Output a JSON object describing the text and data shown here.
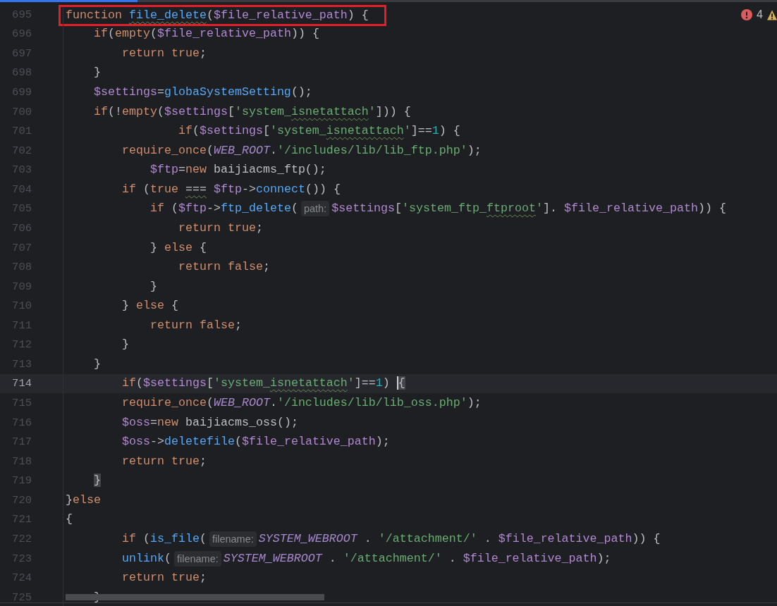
{
  "problems": {
    "errors": "4"
  },
  "lines": [
    {
      "number": "695",
      "current": false,
      "boxed": true,
      "tokens": [
        {
          "text": "function ",
          "kind": "kw"
        },
        {
          "text": "file_delete",
          "kind": "fn",
          "squiggle": true
        },
        {
          "text": "(",
          "kind": "plain"
        },
        {
          "text": "$file_relative_path",
          "kind": "var"
        },
        {
          "text": ") {",
          "kind": "plain"
        }
      ]
    },
    {
      "number": "696",
      "current": false,
      "boxed": false,
      "tokens": [
        {
          "text": "    if",
          "kind": "kw"
        },
        {
          "text": "(",
          "kind": "plain"
        },
        {
          "text": "empty",
          "kind": "kw"
        },
        {
          "text": "(",
          "kind": "plain"
        },
        {
          "text": "$file_relative_path",
          "kind": "var"
        },
        {
          "text": ")) {",
          "kind": "plain"
        }
      ]
    },
    {
      "number": "697",
      "current": false,
      "boxed": false,
      "tokens": [
        {
          "text": "        return true",
          "kind": "kw"
        },
        {
          "text": ";",
          "kind": "plain"
        }
      ]
    },
    {
      "number": "698",
      "current": false,
      "boxed": false,
      "tokens": [
        {
          "text": "    }",
          "kind": "plain"
        }
      ]
    },
    {
      "number": "699",
      "current": false,
      "boxed": false,
      "tokens": [
        {
          "text": "    $settings",
          "kind": "var"
        },
        {
          "text": "=",
          "kind": "plain"
        },
        {
          "text": "globaSystemSetting",
          "kind": "fn"
        },
        {
          "text": "();",
          "kind": "plain"
        }
      ]
    },
    {
      "number": "700",
      "current": false,
      "boxed": false,
      "tokens": [
        {
          "text": "    if",
          "kind": "kw"
        },
        {
          "text": "(!",
          "kind": "plain"
        },
        {
          "text": "empty",
          "kind": "kw"
        },
        {
          "text": "(",
          "kind": "plain"
        },
        {
          "text": "$settings",
          "kind": "var"
        },
        {
          "text": "[",
          "kind": "plain"
        },
        {
          "text": "'system_",
          "kind": "str"
        },
        {
          "text": "isnetattach",
          "kind": "str",
          "squiggle": true
        },
        {
          "text": "'",
          "kind": "str"
        },
        {
          "text": "])) {",
          "kind": "plain"
        }
      ]
    },
    {
      "number": "701",
      "current": false,
      "boxed": false,
      "tokens": [
        {
          "text": "                if",
          "kind": "kw"
        },
        {
          "text": "(",
          "kind": "plain"
        },
        {
          "text": "$settings",
          "kind": "var"
        },
        {
          "text": "[",
          "kind": "plain"
        },
        {
          "text": "'system_",
          "kind": "str"
        },
        {
          "text": "isnetattach",
          "kind": "str",
          "squiggle": true
        },
        {
          "text": "'",
          "kind": "str"
        },
        {
          "text": "]==",
          "kind": "plain"
        },
        {
          "text": "1",
          "kind": "num"
        },
        {
          "text": ") {",
          "kind": "plain"
        }
      ]
    },
    {
      "number": "702",
      "current": false,
      "boxed": false,
      "tokens": [
        {
          "text": "        require_once",
          "kind": "kw"
        },
        {
          "text": "(",
          "kind": "plain"
        },
        {
          "text": "WEB_ROOT",
          "kind": "const"
        },
        {
          "text": ".",
          "kind": "plain"
        },
        {
          "text": "'/includes/lib/lib_ftp.php'",
          "kind": "str"
        },
        {
          "text": ");",
          "kind": "plain"
        }
      ]
    },
    {
      "number": "703",
      "current": false,
      "boxed": false,
      "tokens": [
        {
          "text": "            $ftp",
          "kind": "var"
        },
        {
          "text": "=",
          "kind": "plain"
        },
        {
          "text": "new",
          "kind": "kw"
        },
        {
          "text": " baijiacms_ftp();",
          "kind": "plain"
        }
      ]
    },
    {
      "number": "704",
      "current": false,
      "boxed": false,
      "tokens": [
        {
          "text": "        if",
          "kind": "kw"
        },
        {
          "text": " (",
          "kind": "plain"
        },
        {
          "text": "true ",
          "kind": "kw"
        },
        {
          "text": "===",
          "kind": "plain",
          "squiggle": true
        },
        {
          "text": " $ftp",
          "kind": "var"
        },
        {
          "text": "->",
          "kind": "plain"
        },
        {
          "text": "connect",
          "kind": "fn"
        },
        {
          "text": "()) {",
          "kind": "plain"
        }
      ]
    },
    {
      "number": "705",
      "current": false,
      "boxed": false,
      "tokens": [
        {
          "text": "            if",
          "kind": "kw"
        },
        {
          "text": " (",
          "kind": "plain"
        },
        {
          "text": "$ftp",
          "kind": "var"
        },
        {
          "text": "->",
          "kind": "plain"
        },
        {
          "text": "ftp_delete",
          "kind": "fn"
        },
        {
          "text": "(",
          "kind": "plain"
        },
        {
          "text": "path:",
          "kind": "hint"
        },
        {
          "text": "$settings",
          "kind": "var"
        },
        {
          "text": "[",
          "kind": "plain"
        },
        {
          "text": "'system_ftp_",
          "kind": "str"
        },
        {
          "text": "ftproot",
          "kind": "str",
          "squiggle": true
        },
        {
          "text": "'",
          "kind": "str"
        },
        {
          "text": "]. ",
          "kind": "plain"
        },
        {
          "text": "$file_relative_path",
          "kind": "var"
        },
        {
          "text": ")) {",
          "kind": "plain"
        }
      ]
    },
    {
      "number": "706",
      "current": false,
      "boxed": false,
      "tokens": [
        {
          "text": "                return true",
          "kind": "kw"
        },
        {
          "text": ";",
          "kind": "plain"
        }
      ]
    },
    {
      "number": "707",
      "current": false,
      "boxed": false,
      "tokens": [
        {
          "text": "            } ",
          "kind": "plain"
        },
        {
          "text": "else",
          "kind": "kw"
        },
        {
          "text": " {",
          "kind": "plain"
        }
      ]
    },
    {
      "number": "708",
      "current": false,
      "boxed": false,
      "tokens": [
        {
          "text": "                return false",
          "kind": "kw"
        },
        {
          "text": ";",
          "kind": "plain"
        }
      ]
    },
    {
      "number": "709",
      "current": false,
      "boxed": false,
      "tokens": [
        {
          "text": "            }",
          "kind": "plain"
        }
      ]
    },
    {
      "number": "710",
      "current": false,
      "boxed": false,
      "tokens": [
        {
          "text": "        } ",
          "kind": "plain"
        },
        {
          "text": "else",
          "kind": "kw"
        },
        {
          "text": " {",
          "kind": "plain"
        }
      ]
    },
    {
      "number": "711",
      "current": false,
      "boxed": false,
      "tokens": [
        {
          "text": "            return false",
          "kind": "kw"
        },
        {
          "text": ";",
          "kind": "plain"
        }
      ]
    },
    {
      "number": "712",
      "current": false,
      "boxed": false,
      "tokens": [
        {
          "text": "        }",
          "kind": "plain"
        }
      ]
    },
    {
      "number": "713",
      "current": false,
      "boxed": false,
      "tokens": [
        {
          "text": "    }",
          "kind": "plain"
        }
      ]
    },
    {
      "number": "714",
      "current": true,
      "boxed": false,
      "tokens": [
        {
          "text": "        if",
          "kind": "kw"
        },
        {
          "text": "(",
          "kind": "plain"
        },
        {
          "text": "$settings",
          "kind": "var"
        },
        {
          "text": "[",
          "kind": "plain"
        },
        {
          "text": "'system_",
          "kind": "str"
        },
        {
          "text": "isnetattach",
          "kind": "str",
          "squiggle": true
        },
        {
          "text": "'",
          "kind": "str"
        },
        {
          "text": "]==",
          "kind": "plain"
        },
        {
          "text": "1",
          "kind": "num"
        },
        {
          "text": ") ",
          "kind": "plain"
        },
        {
          "text": "{",
          "kind": "plain",
          "brace_match": true,
          "caret": true
        }
      ]
    },
    {
      "number": "715",
      "current": false,
      "boxed": false,
      "tokens": [
        {
          "text": "        require_once",
          "kind": "kw"
        },
        {
          "text": "(",
          "kind": "plain"
        },
        {
          "text": "WEB_ROOT",
          "kind": "const"
        },
        {
          "text": ".",
          "kind": "plain"
        },
        {
          "text": "'/includes/lib/lib_oss.php'",
          "kind": "str"
        },
        {
          "text": ");",
          "kind": "plain"
        }
      ]
    },
    {
      "number": "716",
      "current": false,
      "boxed": false,
      "tokens": [
        {
          "text": "        $oss",
          "kind": "var"
        },
        {
          "text": "=",
          "kind": "plain"
        },
        {
          "text": "new",
          "kind": "kw"
        },
        {
          "text": " baijiacms_oss();",
          "kind": "plain"
        }
      ]
    },
    {
      "number": "717",
      "current": false,
      "boxed": false,
      "tokens": [
        {
          "text": "        $oss",
          "kind": "var"
        },
        {
          "text": "->",
          "kind": "plain"
        },
        {
          "text": "deletefile",
          "kind": "fn"
        },
        {
          "text": "(",
          "kind": "plain"
        },
        {
          "text": "$file_relative_path",
          "kind": "var"
        },
        {
          "text": ");",
          "kind": "plain"
        }
      ]
    },
    {
      "number": "718",
      "current": false,
      "boxed": false,
      "tokens": [
        {
          "text": "        return true",
          "kind": "kw"
        },
        {
          "text": ";",
          "kind": "plain"
        }
      ]
    },
    {
      "number": "719",
      "current": false,
      "boxed": false,
      "tokens": [
        {
          "text": "    }",
          "kind": "plain",
          "brace_match": true
        }
      ]
    },
    {
      "number": "720",
      "current": false,
      "boxed": false,
      "tokens": [
        {
          "text": "}",
          "kind": "plain"
        },
        {
          "text": "else",
          "kind": "kw"
        }
      ]
    },
    {
      "number": "721",
      "current": false,
      "boxed": false,
      "tokens": [
        {
          "text": "{",
          "kind": "plain"
        }
      ]
    },
    {
      "number": "722",
      "current": false,
      "boxed": false,
      "tokens": [
        {
          "text": "        if",
          "kind": "kw"
        },
        {
          "text": " (",
          "kind": "plain"
        },
        {
          "text": "is_file",
          "kind": "fn"
        },
        {
          "text": "(",
          "kind": "plain"
        },
        {
          "text": "filename:",
          "kind": "hint"
        },
        {
          "text": "SYSTEM_WEBROOT",
          "kind": "const"
        },
        {
          "text": " . ",
          "kind": "plain"
        },
        {
          "text": "'/attachment/'",
          "kind": "str"
        },
        {
          "text": " . ",
          "kind": "plain"
        },
        {
          "text": "$file_relative_path",
          "kind": "var"
        },
        {
          "text": ")) {",
          "kind": "plain"
        }
      ]
    },
    {
      "number": "723",
      "current": false,
      "boxed": false,
      "tokens": [
        {
          "text": "        unlink",
          "kind": "fn"
        },
        {
          "text": "(",
          "kind": "plain"
        },
        {
          "text": "filename:",
          "kind": "hint"
        },
        {
          "text": "SYSTEM_WEBROOT",
          "kind": "const"
        },
        {
          "text": " . ",
          "kind": "plain"
        },
        {
          "text": "'/attachment/'",
          "kind": "str"
        },
        {
          "text": " . ",
          "kind": "plain"
        },
        {
          "text": "$file_relative_path",
          "kind": "var"
        },
        {
          "text": ");",
          "kind": "plain"
        }
      ]
    },
    {
      "number": "724",
      "current": false,
      "boxed": false,
      "tokens": [
        {
          "text": "        return true",
          "kind": "kw"
        },
        {
          "text": ";",
          "kind": "plain"
        }
      ]
    },
    {
      "number": "725",
      "current": false,
      "boxed": false,
      "tokens": [
        {
          "text": "    }",
          "kind": "plain"
        }
      ]
    }
  ]
}
